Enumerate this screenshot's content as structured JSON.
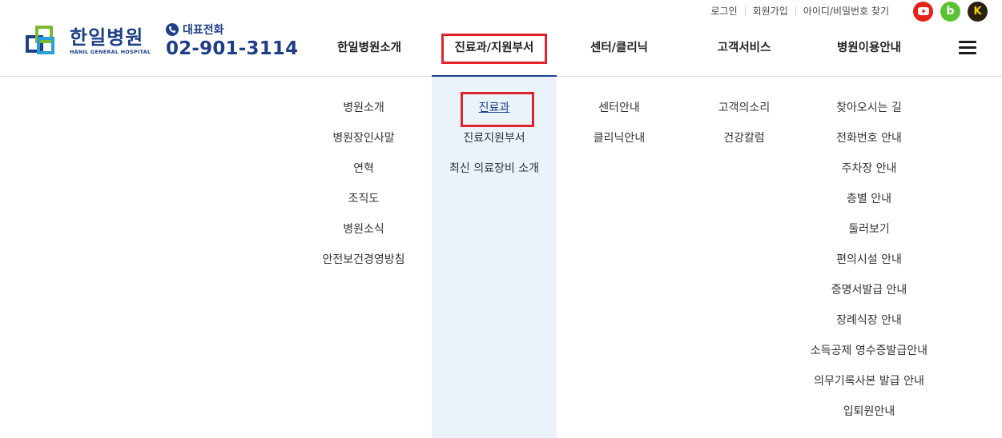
{
  "util": {
    "links": [
      "로그인",
      "회원가입",
      "아이디/비밀번호 찾기"
    ]
  },
  "social": {
    "youtube_icon": "youtube-icon",
    "blog_label": "b",
    "kakao_label": "K",
    "colors": {
      "youtube": "#e62117",
      "blog": "#5bc236",
      "kakao": "#2b1f0e"
    }
  },
  "logo": {
    "name_ko": "한일병원",
    "name_en": "HANIL GENERAL HOSPITAL"
  },
  "phone": {
    "label": "대표전화",
    "number": "02-901-3114"
  },
  "gnb": {
    "items": [
      "한일병원소개",
      "진료과/지원부서",
      "센터/클리닉",
      "고객서비스",
      "병원이용안내"
    ],
    "active_index": 1
  },
  "submenu": {
    "intro": [
      "병원소개",
      "병원장인사말",
      "연혁",
      "조직도",
      "병원소식",
      "안전보건경영방침"
    ],
    "departments": [
      "진료과",
      "진료지원부서",
      "최신 의료장비 소개"
    ],
    "centers": [
      "센터안내",
      "클리닉안내"
    ],
    "service": [
      "고객의소리",
      "건강칼럼"
    ],
    "guide": [
      "찾아오시는 길",
      "전화번호 안내",
      "주차장 안내",
      "층별 안내",
      "둘러보기",
      "편의시설 안내",
      "증명서발급 안내",
      "장례식장 안내",
      "소득공제 영수증발급안내",
      "의무기록사본 발급 안내",
      "입퇴원안내"
    ]
  },
  "colors": {
    "brand": "#1e3f88",
    "highlight": "#e0242c",
    "active_column": "#eaf2fa"
  }
}
